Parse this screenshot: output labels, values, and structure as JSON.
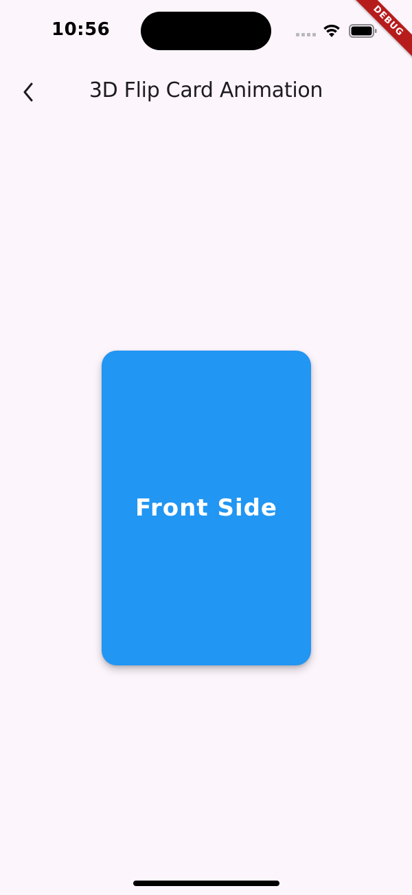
{
  "status_bar": {
    "time": "10:56",
    "signal_icon": "cellular-signal-icon",
    "wifi_icon": "wifi-icon",
    "battery_icon": "battery-full-icon"
  },
  "debug_banner": {
    "label": "DEBUG",
    "color": "#B71C1C"
  },
  "app_bar": {
    "back_icon": "chevron-left-icon",
    "title": "3D Flip Card Animation"
  },
  "card": {
    "label": "Front Side",
    "color": "#2196F3"
  },
  "colors": {
    "background": "#FCF5FC",
    "text": "#1D1B20"
  }
}
